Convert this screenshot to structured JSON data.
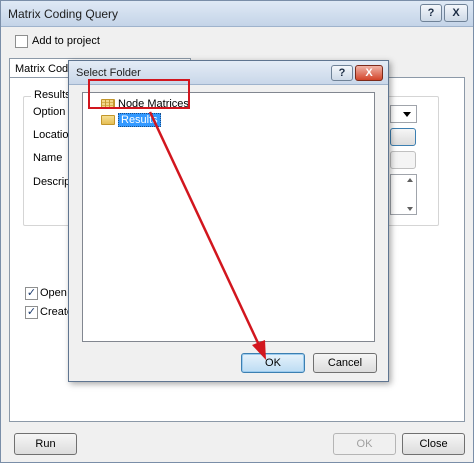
{
  "main_window": {
    "title": "Matrix Coding Query",
    "help_button": "?",
    "close_button": "X",
    "add_to_project": {
      "label": "Add to project",
      "checked": false
    },
    "tab_label": "Matrix Codin",
    "results_group": {
      "legend": "Results",
      "option_label": "Option",
      "location_label": "Location",
      "name_label": "Name",
      "description_label": "Descripti"
    },
    "open_results": {
      "label": "Open re",
      "checked": true
    },
    "create_results": {
      "label": "Create",
      "checked": true
    },
    "footer": {
      "run_button": "Run",
      "ok_button": "OK",
      "close_button": "Close"
    }
  },
  "select_folder_dialog": {
    "title": "Select Folder",
    "help_button": "?",
    "close_button": "X",
    "tree": [
      {
        "label": "Node Matrices",
        "selected": false
      },
      {
        "label": "Results",
        "selected": true
      }
    ],
    "ok_button": "OK",
    "cancel_button": "Cancel"
  },
  "annotation": {
    "highlight_color": "#d2161e",
    "arrow_color": "#d2161e"
  }
}
